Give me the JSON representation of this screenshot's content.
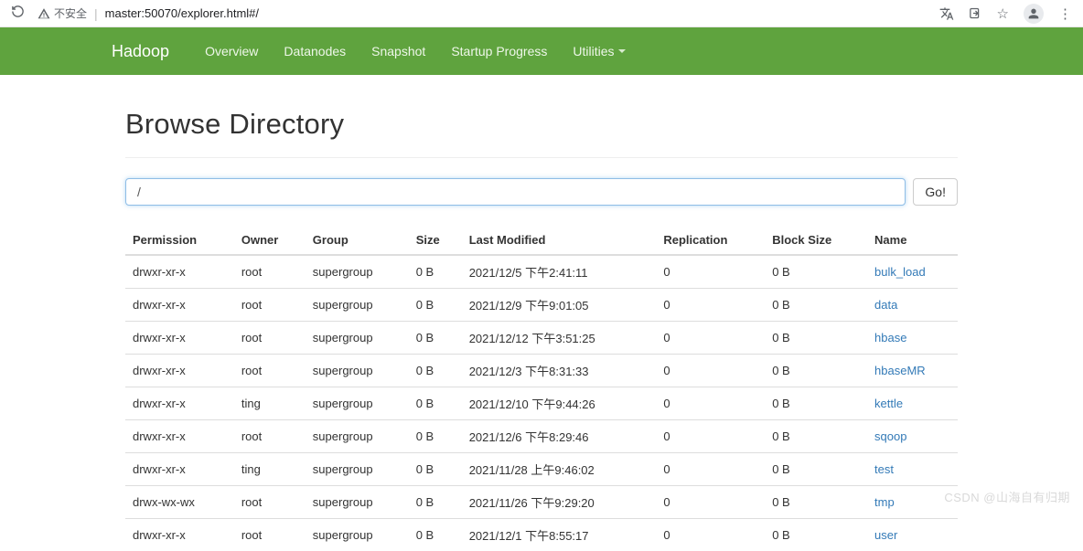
{
  "browser": {
    "insecure_label": "不安全",
    "url": "master:50070/explorer.html#/"
  },
  "nav": {
    "brand": "Hadoop",
    "items": [
      "Overview",
      "Datanodes",
      "Snapshot",
      "Startup Progress",
      "Utilities"
    ]
  },
  "page": {
    "title": "Browse Directory",
    "path_value": "/",
    "go_label": "Go!"
  },
  "table": {
    "headers": [
      "Permission",
      "Owner",
      "Group",
      "Size",
      "Last Modified",
      "Replication",
      "Block Size",
      "Name"
    ],
    "rows": [
      {
        "perm": "drwxr-xr-x",
        "owner": "root",
        "group": "supergroup",
        "size": "0 B",
        "mod": "2021/12/5 下午2:41:11",
        "rep": "0",
        "bs": "0 B",
        "name": "bulk_load"
      },
      {
        "perm": "drwxr-xr-x",
        "owner": "root",
        "group": "supergroup",
        "size": "0 B",
        "mod": "2021/12/9 下午9:01:05",
        "rep": "0",
        "bs": "0 B",
        "name": "data"
      },
      {
        "perm": "drwxr-xr-x",
        "owner": "root",
        "group": "supergroup",
        "size": "0 B",
        "mod": "2021/12/12 下午3:51:25",
        "rep": "0",
        "bs": "0 B",
        "name": "hbase"
      },
      {
        "perm": "drwxr-xr-x",
        "owner": "root",
        "group": "supergroup",
        "size": "0 B",
        "mod": "2021/12/3 下午8:31:33",
        "rep": "0",
        "bs": "0 B",
        "name": "hbaseMR"
      },
      {
        "perm": "drwxr-xr-x",
        "owner": "ting",
        "group": "supergroup",
        "size": "0 B",
        "mod": "2021/12/10 下午9:44:26",
        "rep": "0",
        "bs": "0 B",
        "name": "kettle"
      },
      {
        "perm": "drwxr-xr-x",
        "owner": "root",
        "group": "supergroup",
        "size": "0 B",
        "mod": "2021/12/6 下午8:29:46",
        "rep": "0",
        "bs": "0 B",
        "name": "sqoop"
      },
      {
        "perm": "drwxr-xr-x",
        "owner": "ting",
        "group": "supergroup",
        "size": "0 B",
        "mod": "2021/11/28 上午9:46:02",
        "rep": "0",
        "bs": "0 B",
        "name": "test"
      },
      {
        "perm": "drwx-wx-wx",
        "owner": "root",
        "group": "supergroup",
        "size": "0 B",
        "mod": "2021/11/26 下午9:29:20",
        "rep": "0",
        "bs": "0 B",
        "name": "tmp"
      },
      {
        "perm": "drwxr-xr-x",
        "owner": "root",
        "group": "supergroup",
        "size": "0 B",
        "mod": "2021/12/1 下午8:55:17",
        "rep": "0",
        "bs": "0 B",
        "name": "user"
      }
    ]
  },
  "watermark": "CSDN @山海自有归期"
}
